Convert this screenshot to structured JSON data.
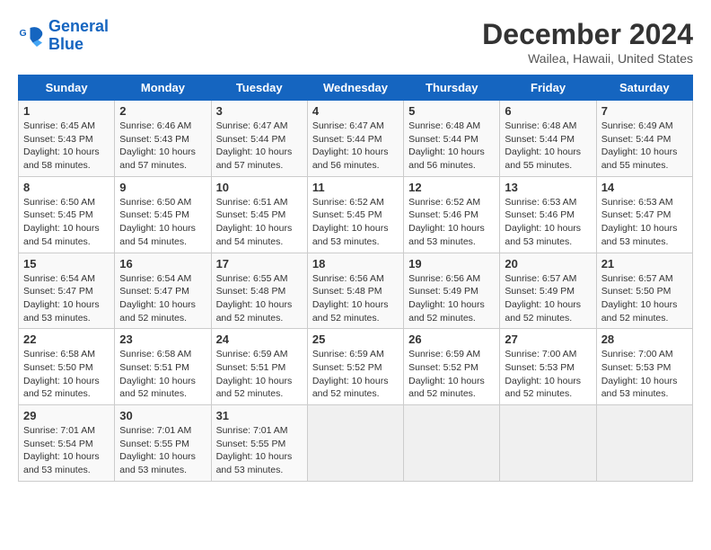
{
  "header": {
    "logo_line1": "General",
    "logo_line2": "Blue",
    "month_title": "December 2024",
    "location": "Wailea, Hawaii, United States"
  },
  "weekdays": [
    "Sunday",
    "Monday",
    "Tuesday",
    "Wednesday",
    "Thursday",
    "Friday",
    "Saturday"
  ],
  "weeks": [
    [
      {
        "day": "1",
        "sunrise": "6:45 AM",
        "sunset": "5:43 PM",
        "daylight": "10 hours and 58 minutes."
      },
      {
        "day": "2",
        "sunrise": "6:46 AM",
        "sunset": "5:43 PM",
        "daylight": "10 hours and 57 minutes."
      },
      {
        "day": "3",
        "sunrise": "6:47 AM",
        "sunset": "5:44 PM",
        "daylight": "10 hours and 57 minutes."
      },
      {
        "day": "4",
        "sunrise": "6:47 AM",
        "sunset": "5:44 PM",
        "daylight": "10 hours and 56 minutes."
      },
      {
        "day": "5",
        "sunrise": "6:48 AM",
        "sunset": "5:44 PM",
        "daylight": "10 hours and 56 minutes."
      },
      {
        "day": "6",
        "sunrise": "6:48 AM",
        "sunset": "5:44 PM",
        "daylight": "10 hours and 55 minutes."
      },
      {
        "day": "7",
        "sunrise": "6:49 AM",
        "sunset": "5:44 PM",
        "daylight": "10 hours and 55 minutes."
      }
    ],
    [
      {
        "day": "8",
        "sunrise": "6:50 AM",
        "sunset": "5:45 PM",
        "daylight": "10 hours and 54 minutes."
      },
      {
        "day": "9",
        "sunrise": "6:50 AM",
        "sunset": "5:45 PM",
        "daylight": "10 hours and 54 minutes."
      },
      {
        "day": "10",
        "sunrise": "6:51 AM",
        "sunset": "5:45 PM",
        "daylight": "10 hours and 54 minutes."
      },
      {
        "day": "11",
        "sunrise": "6:52 AM",
        "sunset": "5:45 PM",
        "daylight": "10 hours and 53 minutes."
      },
      {
        "day": "12",
        "sunrise": "6:52 AM",
        "sunset": "5:46 PM",
        "daylight": "10 hours and 53 minutes."
      },
      {
        "day": "13",
        "sunrise": "6:53 AM",
        "sunset": "5:46 PM",
        "daylight": "10 hours and 53 minutes."
      },
      {
        "day": "14",
        "sunrise": "6:53 AM",
        "sunset": "5:47 PM",
        "daylight": "10 hours and 53 minutes."
      }
    ],
    [
      {
        "day": "15",
        "sunrise": "6:54 AM",
        "sunset": "5:47 PM",
        "daylight": "10 hours and 53 minutes."
      },
      {
        "day": "16",
        "sunrise": "6:54 AM",
        "sunset": "5:47 PM",
        "daylight": "10 hours and 52 minutes."
      },
      {
        "day": "17",
        "sunrise": "6:55 AM",
        "sunset": "5:48 PM",
        "daylight": "10 hours and 52 minutes."
      },
      {
        "day": "18",
        "sunrise": "6:56 AM",
        "sunset": "5:48 PM",
        "daylight": "10 hours and 52 minutes."
      },
      {
        "day": "19",
        "sunrise": "6:56 AM",
        "sunset": "5:49 PM",
        "daylight": "10 hours and 52 minutes."
      },
      {
        "day": "20",
        "sunrise": "6:57 AM",
        "sunset": "5:49 PM",
        "daylight": "10 hours and 52 minutes."
      },
      {
        "day": "21",
        "sunrise": "6:57 AM",
        "sunset": "5:50 PM",
        "daylight": "10 hours and 52 minutes."
      }
    ],
    [
      {
        "day": "22",
        "sunrise": "6:58 AM",
        "sunset": "5:50 PM",
        "daylight": "10 hours and 52 minutes."
      },
      {
        "day": "23",
        "sunrise": "6:58 AM",
        "sunset": "5:51 PM",
        "daylight": "10 hours and 52 minutes."
      },
      {
        "day": "24",
        "sunrise": "6:59 AM",
        "sunset": "5:51 PM",
        "daylight": "10 hours and 52 minutes."
      },
      {
        "day": "25",
        "sunrise": "6:59 AM",
        "sunset": "5:52 PM",
        "daylight": "10 hours and 52 minutes."
      },
      {
        "day": "26",
        "sunrise": "6:59 AM",
        "sunset": "5:52 PM",
        "daylight": "10 hours and 52 minutes."
      },
      {
        "day": "27",
        "sunrise": "7:00 AM",
        "sunset": "5:53 PM",
        "daylight": "10 hours and 52 minutes."
      },
      {
        "day": "28",
        "sunrise": "7:00 AM",
        "sunset": "5:53 PM",
        "daylight": "10 hours and 53 minutes."
      }
    ],
    [
      {
        "day": "29",
        "sunrise": "7:01 AM",
        "sunset": "5:54 PM",
        "daylight": "10 hours and 53 minutes."
      },
      {
        "day": "30",
        "sunrise": "7:01 AM",
        "sunset": "5:55 PM",
        "daylight": "10 hours and 53 minutes."
      },
      {
        "day": "31",
        "sunrise": "7:01 AM",
        "sunset": "5:55 PM",
        "daylight": "10 hours and 53 minutes."
      },
      null,
      null,
      null,
      null
    ]
  ]
}
